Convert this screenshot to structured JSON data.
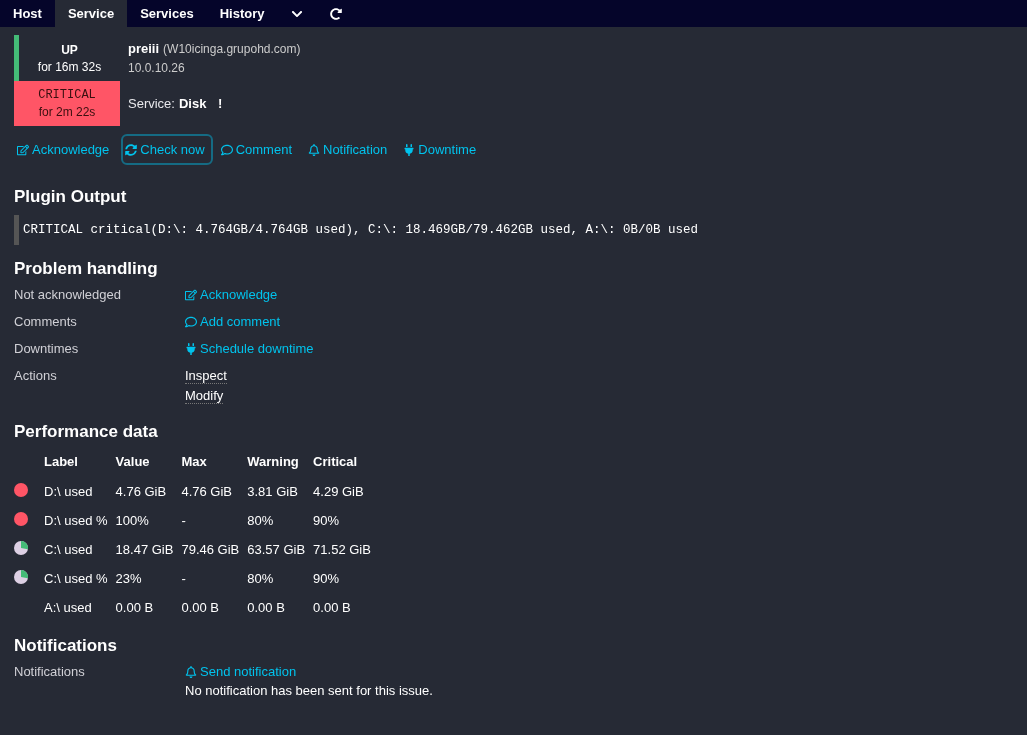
{
  "tabs": [
    {
      "label": "Host",
      "selected": false
    },
    {
      "label": "Service",
      "selected": true
    },
    {
      "label": "Services",
      "selected": false
    },
    {
      "label": "History",
      "selected": false
    }
  ],
  "host": {
    "state": "UP",
    "kind": "up",
    "duration": "for 16m 32s",
    "name": "preiii",
    "display": "(W10icinga.grupohd.com)",
    "address": "10.0.10.26"
  },
  "service": {
    "state": "CRITICAL",
    "kind": "critical",
    "duration": "for 2m 22s",
    "label": "Service:",
    "name": "Disk",
    "flag": "!"
  },
  "actions": [
    {
      "kind": "acknowledge",
      "label": "Acknowledge",
      "focused": false
    },
    {
      "kind": "check",
      "label": "Check now",
      "focused": true
    },
    {
      "kind": "comment",
      "label": "Comment",
      "focused": false
    },
    {
      "kind": "notification",
      "label": "Notification",
      "focused": false
    },
    {
      "kind": "downtime",
      "label": "Downtime",
      "focused": false
    }
  ],
  "plugin_output": {
    "title": "Plugin Output",
    "text": "CRITICAL critical(D:\\: 4.764GB/4.764GB used), C:\\: 18.469GB/79.462GB used, A:\\: 0B/0B used"
  },
  "problem_handling": {
    "title": "Problem handling",
    "rows": [
      {
        "label": "Not acknowledged",
        "links": [
          {
            "kind": "acknowledge",
            "label": "Acknowledge"
          }
        ]
      },
      {
        "label": "Comments",
        "links": [
          {
            "kind": "comment",
            "label": "Add comment"
          }
        ]
      },
      {
        "label": "Downtimes",
        "links": [
          {
            "kind": "downtime",
            "label": "Schedule downtime"
          }
        ]
      },
      {
        "label": "Actions",
        "links": [
          {
            "kind": "plain",
            "label": "Inspect"
          },
          {
            "kind": "plain",
            "label": "Modify"
          }
        ]
      }
    ]
  },
  "performance": {
    "title": "Performance data",
    "columns": [
      "Label",
      "Value",
      "Max",
      "Warning",
      "Critical"
    ],
    "rows": [
      {
        "kind": "critical",
        "cells": [
          "D:\\ used",
          "4.76 GiB",
          "4.76 GiB",
          "3.81 GiB",
          "4.29 GiB"
        ]
      },
      {
        "kind": "critical",
        "cells": [
          "D:\\ used %",
          "100%",
          "-",
          "80%",
          "90%"
        ]
      },
      {
        "kind": "ok",
        "cells": [
          "C:\\ used",
          "18.47 GiB",
          "79.46 GiB",
          "63.57 GiB",
          "71.52 GiB"
        ]
      },
      {
        "kind": "ok",
        "cells": [
          "C:\\ used %",
          "23%",
          "-",
          "80%",
          "90%"
        ]
      },
      {
        "kind": "none",
        "cells": [
          "A:\\ used",
          "0.00 B",
          "0.00 B",
          "0.00 B",
          "0.00 B"
        ]
      }
    ]
  },
  "notifications": {
    "title": "Notifications",
    "label": "Notifications",
    "link": {
      "kind": "notification",
      "label": "Send notification"
    },
    "message": "No notification has been sent for this issue."
  }
}
